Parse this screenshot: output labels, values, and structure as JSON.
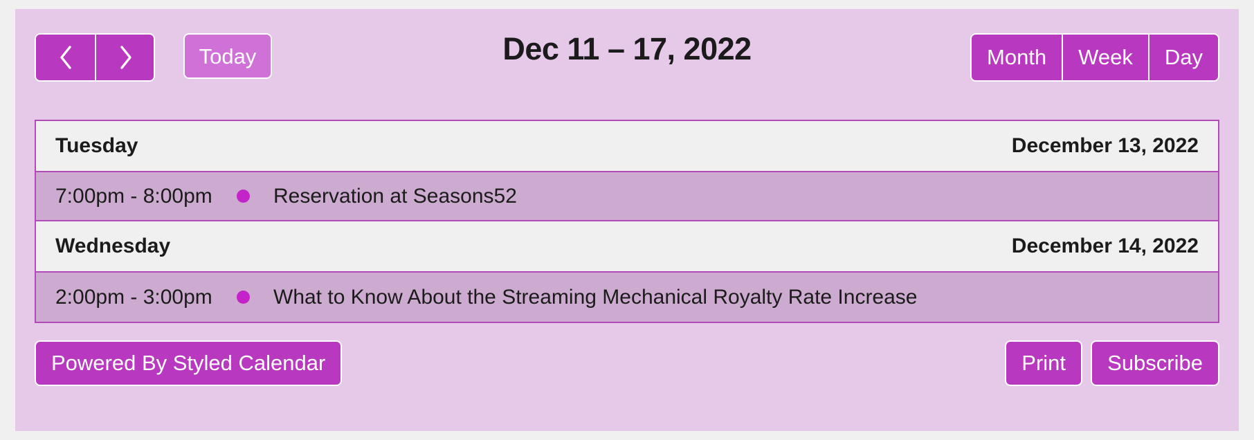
{
  "toolbar": {
    "prev_label": "chevron-left",
    "next_label": "chevron-right",
    "today_label": "Today",
    "title": "Dec 11 – 17, 2022",
    "views": [
      {
        "label": "Month"
      },
      {
        "label": "Week"
      },
      {
        "label": "Day"
      }
    ]
  },
  "agenda": {
    "days": [
      {
        "weekday": "Tuesday",
        "date": "December 13, 2022",
        "events": [
          {
            "time": "7:00pm - 8:00pm",
            "title": "Reservation at Seasons52",
            "dot_color": "#c423c9"
          }
        ]
      },
      {
        "weekday": "Wednesday",
        "date": "December 14, 2022",
        "events": [
          {
            "time": "2:00pm - 3:00pm",
            "title": "What to Know About the Streaming Mechanical Royalty Rate Increase",
            "dot_color": "#c423c9"
          }
        ]
      }
    ]
  },
  "footer": {
    "powered_by_label": "Powered By Styled Calendar",
    "print_label": "Print",
    "subscribe_label": "Subscribe"
  },
  "colors": {
    "page_background": "#f0f0f0",
    "calendar_background": "#e6c8e8",
    "accent_purple": "#b938c0",
    "today_purple": "#d071d8",
    "border_purple": "#b14bb8",
    "day_header_background": "#f0f0f0",
    "event_row_background": "#cdaacf",
    "text_dark": "#1b1b1b",
    "text_light": "#ffffff"
  }
}
